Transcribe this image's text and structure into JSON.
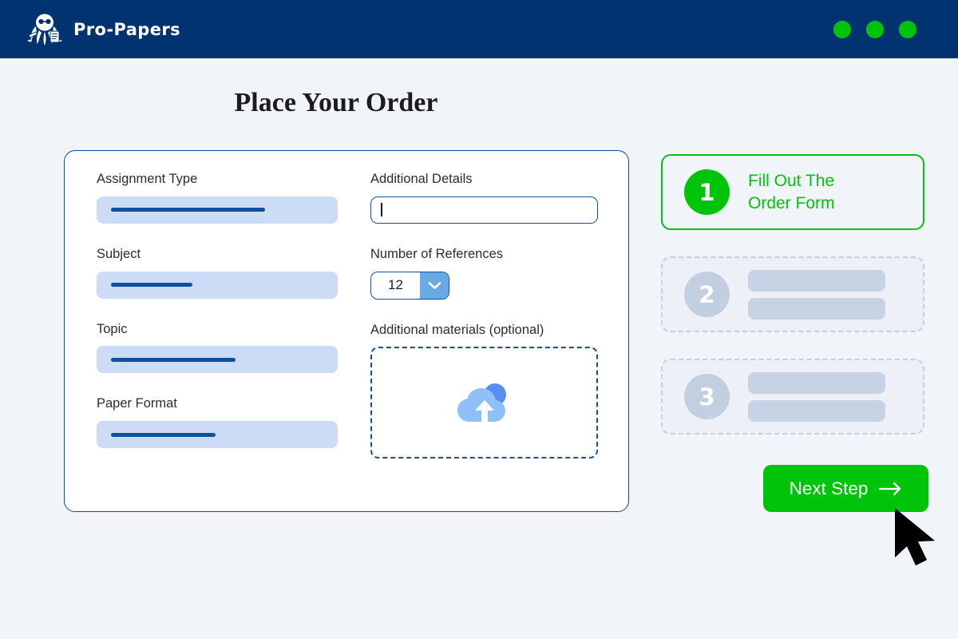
{
  "header": {
    "brand_name": "Pro-Papers",
    "logo_icon": "octopus-mascot-logo",
    "status_dots": [
      {
        "name": "status-dot-1",
        "color": "#00c40a"
      },
      {
        "name": "status-dot-2",
        "color": "#00c40a"
      },
      {
        "name": "status-dot-3",
        "color": "#00c40a"
      }
    ],
    "background_color": "#003370"
  },
  "page_title": "Place Your Order",
  "form": {
    "left_fields": [
      {
        "label": "Assignment Type",
        "value": "",
        "filled": true,
        "bar_width": "68%"
      },
      {
        "label": "Subject",
        "value": "",
        "filled": true,
        "bar_width": "36%"
      },
      {
        "label": "Topic",
        "value": "",
        "filled": true,
        "bar_width": "55%"
      },
      {
        "label": "Paper Format",
        "value": "",
        "filled": true,
        "bar_width": "46%"
      }
    ],
    "additional_details": {
      "label": "Additional Details",
      "value": "",
      "placeholder": "",
      "focused": true
    },
    "number_of_references": {
      "label": "Number of References",
      "value": "12",
      "dropdown_icon": "chevron-down-icon",
      "options": [
        "12"
      ]
    },
    "additional_materials": {
      "label": "Additional materials (optional)",
      "upload_icon": "cloud-upload-icon"
    }
  },
  "steps": [
    {
      "number": "1",
      "label": "Fill Out The\nOrder Form",
      "line1": "Fill Out The",
      "line2": "Order Form",
      "state": "active",
      "color": "#00c40a"
    },
    {
      "number": "2",
      "label": "",
      "state": "idle",
      "color": "#c2cfe0"
    },
    {
      "number": "3",
      "label": "",
      "state": "idle",
      "color": "#c2cfe0"
    }
  ],
  "next_button": {
    "label": "Next Step",
    "icon": "arrow-right-icon",
    "color": "#00c40a"
  },
  "cursor": {
    "icon": "mouse-pointer-icon"
  },
  "colors": {
    "page_background": "#f1f4f8",
    "navy": "#003370",
    "accent_blue": "#12509e",
    "field_fill": "#ccdcf6",
    "green": "#00c40a"
  }
}
